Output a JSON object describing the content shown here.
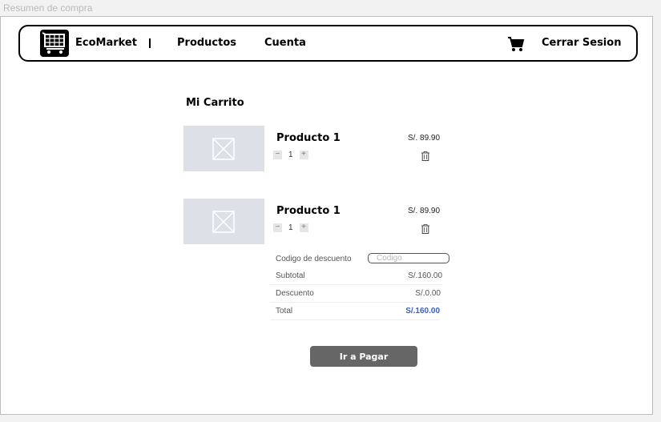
{
  "page": {
    "label": "Resumen de compra"
  },
  "nav": {
    "brand": "EcoMarket",
    "separator": "|",
    "products": "Productos",
    "account": "Cuenta",
    "cart_icon": "shopping-cart-icon",
    "logout": "Cerrar Sesion"
  },
  "cart": {
    "title": "Mi Carrito",
    "items": [
      {
        "name": "Producto 1",
        "price": "S/. 89.90",
        "quantity": "1",
        "minus": "−",
        "plus": "+",
        "image_icon": "image-placeholder-icon"
      },
      {
        "name": "Producto 1",
        "price": "S/. 89.90",
        "quantity": "1",
        "minus": "−",
        "plus": "+",
        "image_icon": "image-placeholder-icon"
      }
    ]
  },
  "summary": {
    "discount_label": "Codigo de descuento",
    "discount_placeholder": "Codigo",
    "subtotal_label": "Subtotal",
    "subtotal_value": "S/.160.00",
    "discount_row_label": "Descuento",
    "discount_value": "S/.0.00",
    "total_label": "Total",
    "total_value": "S/.160.00"
  },
  "actions": {
    "pay": "Ir a Pagar"
  },
  "colors": {
    "total": "#3b5fc0",
    "button": "#666666",
    "thumb": "#dde1e7"
  }
}
